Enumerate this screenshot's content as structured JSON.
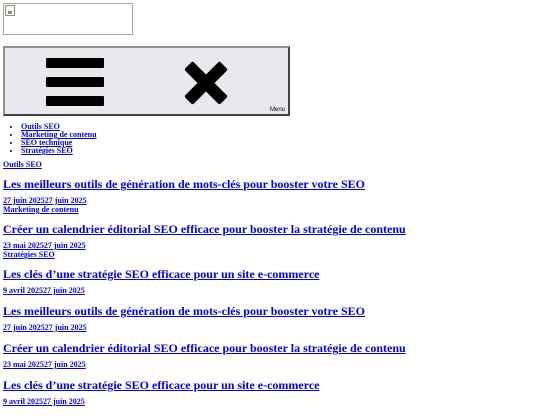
{
  "header": {
    "menu_label": "Menu"
  },
  "nav": {
    "items": [
      "Outils SEO",
      "Marketing de contenu",
      "SEO technique",
      "Stratégies SEO"
    ]
  },
  "articles": [
    {
      "category": "Outils SEO",
      "title": "Les meilleurs outils de génération de mots-clés pour booster votre SEO",
      "dates": "27 juin 202527 juin 2025"
    },
    {
      "category": "Marketing de contenu",
      "title": "Créer un calendrier éditorial SEO efficace pour booster la stratégie de contenu",
      "dates": "23 mai 202527 juin 2025"
    },
    {
      "category": "Stratégies SEO",
      "title": "Les clés d’une stratégie SEO efficace pour un site e-commerce",
      "dates": "9 avril 202527 juin 2025"
    }
  ],
  "list": [
    {
      "title": "Les meilleurs outils de génération de mots-clés pour booster votre SEO",
      "dates": "27 juin 202527 juin 2025"
    },
    {
      "title": "Créer un calendrier éditorial SEO efficace pour booster la stratégie de contenu",
      "dates": "23 mai 202527 juin 2025"
    },
    {
      "title": "Les clés d’une stratégie SEO efficace pour un site e-commerce",
      "dates": "9 avril 202527 juin 2025"
    }
  ],
  "colors": {
    "link": "#0000ee",
    "button_bg": "#e9e9ed"
  }
}
